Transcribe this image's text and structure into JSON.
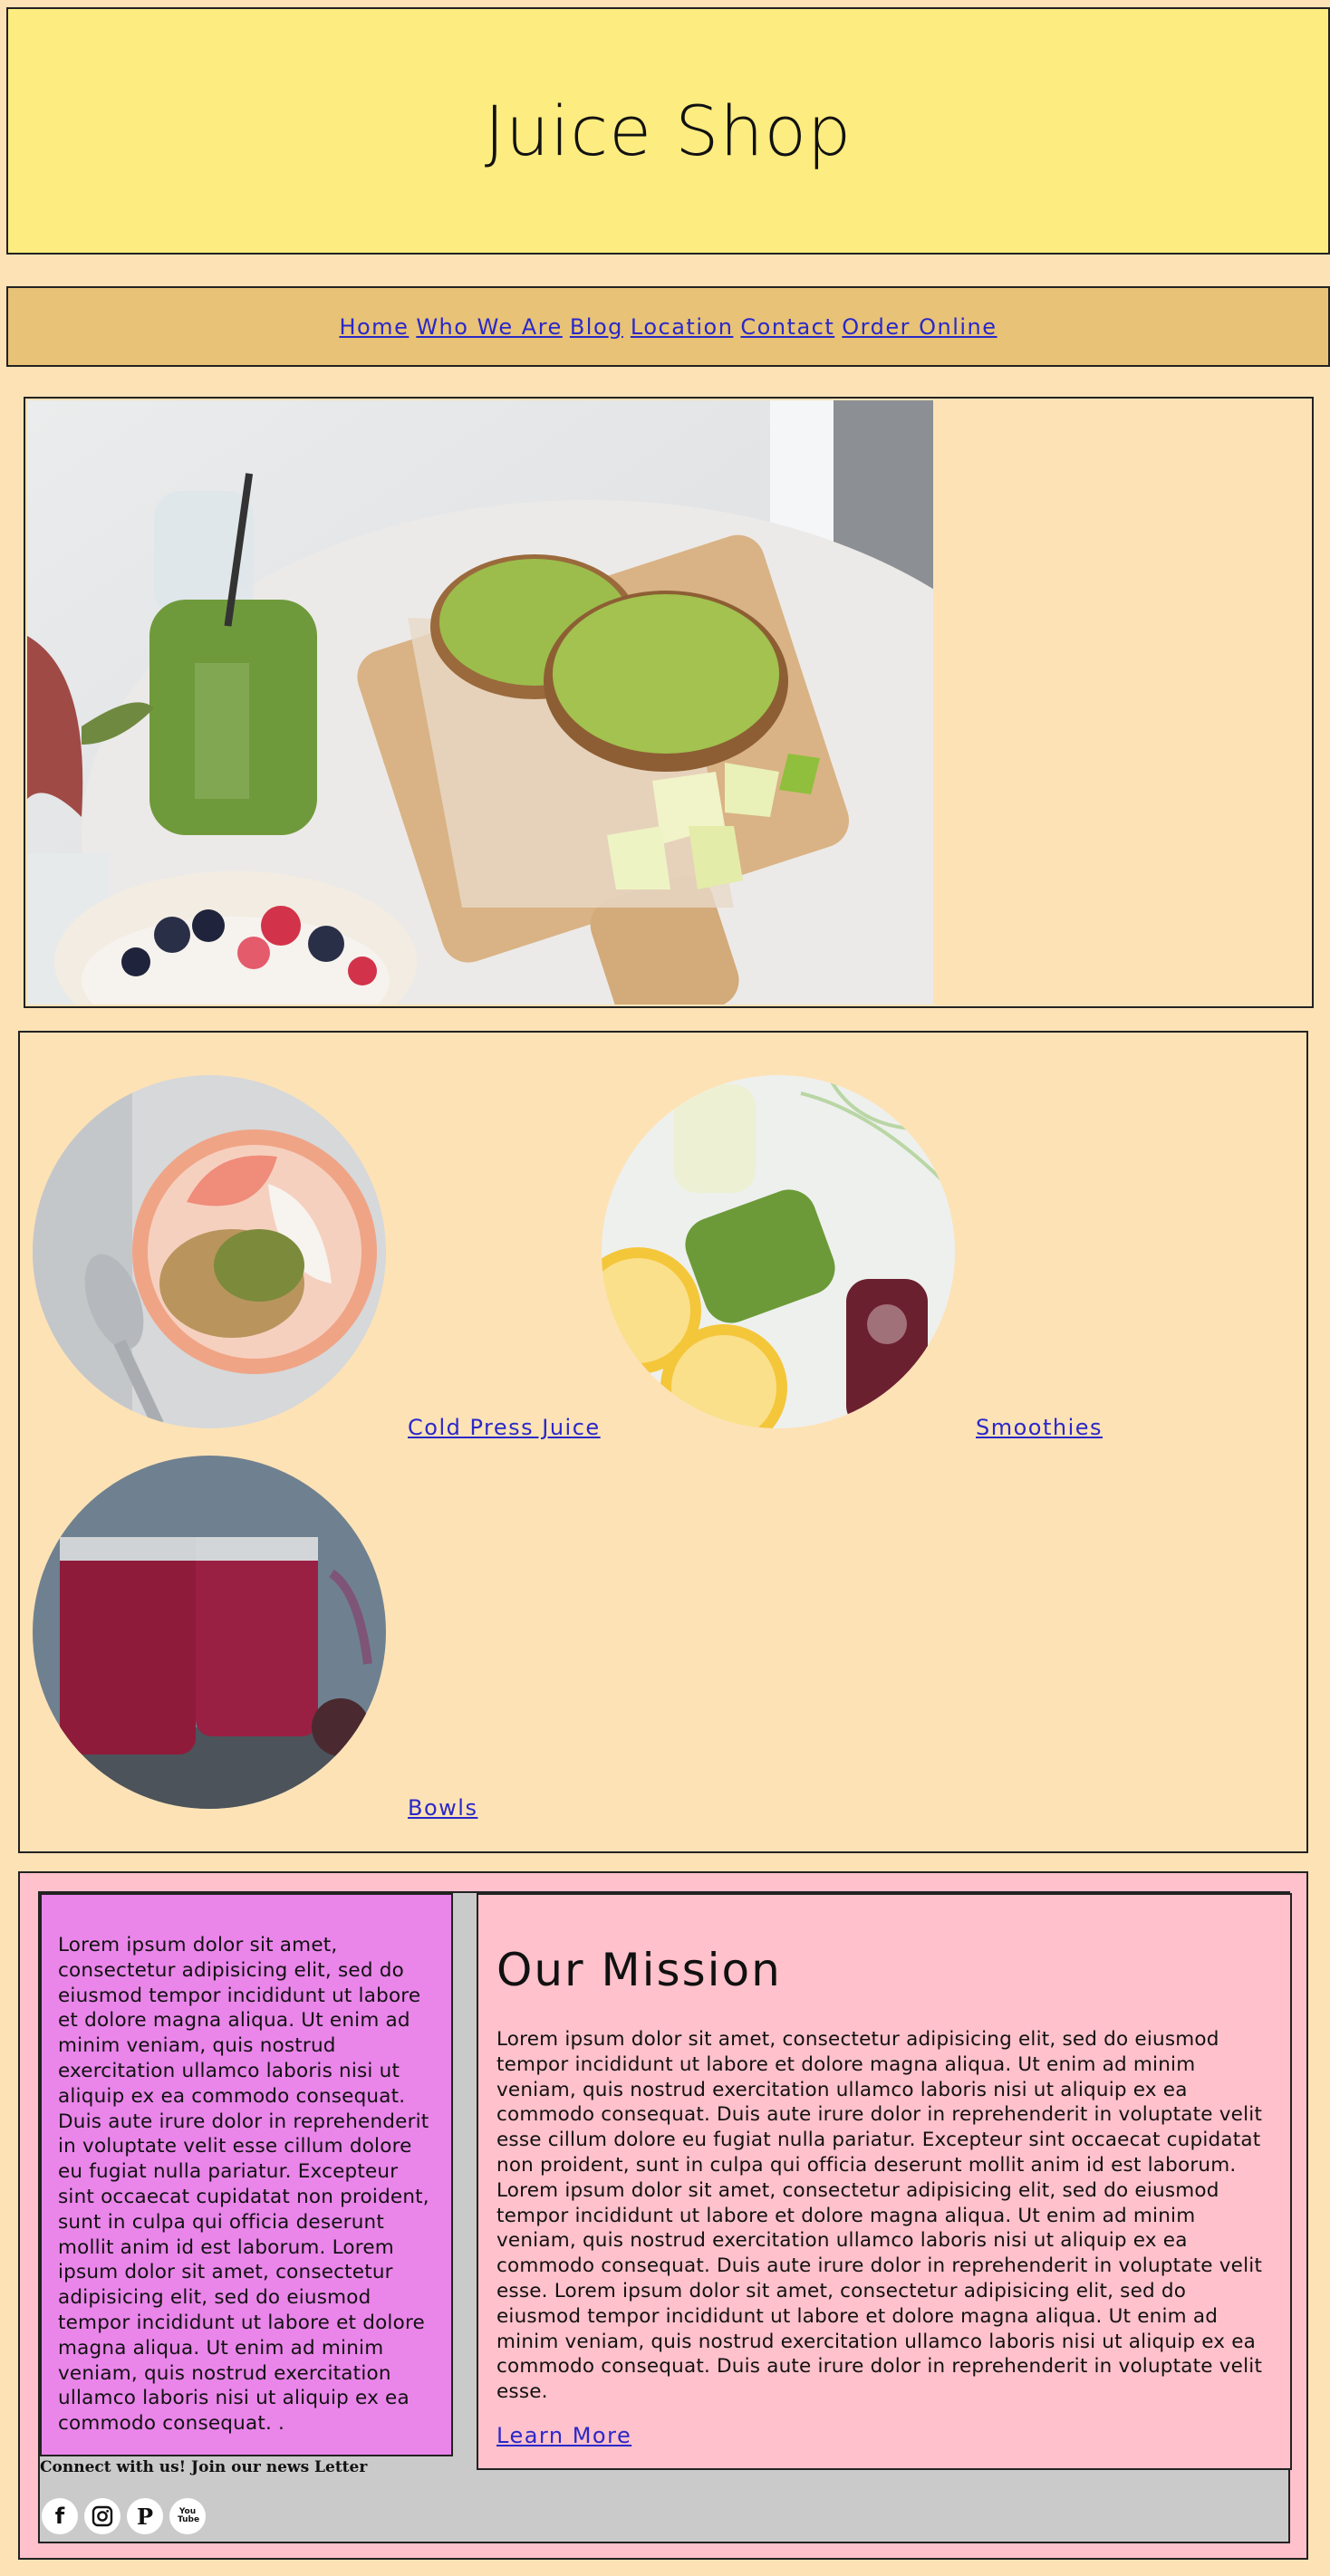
{
  "header": {
    "title": "Juice Shop"
  },
  "nav": {
    "items": [
      {
        "label": "Home"
      },
      {
        "label": "Who We Are"
      },
      {
        "label": "Blog"
      },
      {
        "label": "Location"
      },
      {
        "label": "Contact"
      },
      {
        "label": "Order Online"
      }
    ]
  },
  "products": {
    "items": [
      {
        "label": "Cold Press Juice"
      },
      {
        "label": "Smoothies"
      },
      {
        "label": "Bowls"
      }
    ]
  },
  "intro": {
    "text": "Lorem ipsum dolor sit amet, consectetur adipisicing elit, sed do eiusmod tempor incididunt ut labore et dolore magna aliqua. Ut enim ad minim veniam, quis nostrud exercitation ullamco laboris nisi ut aliquip ex ea commodo consequat. Duis aute irure dolor in reprehenderit in voluptate velit esse cillum dolore eu fugiat nulla pariatur. Excepteur sint occaecat cupidatat non proident, sunt in culpa qui officia deserunt mollit anim id est laborum. Lorem ipsum dolor sit amet, consectetur adipisicing elit, sed do eiusmod tempor incididunt ut labore et dolore magna aliqua. Ut enim ad minim veniam, quis nostrud exercitation ullamco laboris nisi ut aliquip ex ea commodo consequat. ."
  },
  "mission": {
    "title": "Our Mission",
    "text": "Lorem ipsum dolor sit amet, consectetur adipisicing elit, sed do eiusmod tempor incididunt ut labore et dolore magna aliqua. Ut enim ad minim veniam, quis nostrud exercitation ullamco laboris nisi ut aliquip ex ea commodo consequat. Duis aute irure dolor in reprehenderit in voluptate velit esse cillum dolore eu fugiat nulla pariatur. Excepteur sint occaecat cupidatat non proident, sunt in culpa qui officia deserunt mollit anim id est laborum. Lorem ipsum dolor sit amet, consectetur adipisicing elit, sed do eiusmod tempor incididunt ut labore et dolore magna aliqua. Ut enim ad minim veniam, quis nostrud exercitation ullamco laboris nisi ut aliquip ex ea commodo consequat. Duis aute irure dolor in reprehenderit in voluptate velit esse. Lorem ipsum dolor sit amet, consectetur adipisicing elit, sed do eiusmod tempor incididunt ut labore et dolore magna aliqua. Ut enim ad minim veniam, quis nostrud exercitation ullamco laboris nisi ut aliquip ex ea commodo consequat. Duis aute irure dolor in reprehenderit in voluptate velit esse.",
    "link": "Learn More"
  },
  "footer": {
    "connect": "Connect with us! Join our news Letter",
    "socials": [
      {
        "icon": "facebook-icon",
        "glyph": "f"
      },
      {
        "icon": "instagram-icon"
      },
      {
        "icon": "pinterest-icon",
        "glyph": "P"
      },
      {
        "icon": "youtube-icon",
        "glyph": "You Tube"
      }
    ]
  },
  "colors": {
    "page_bg": "#fde2b6",
    "header_bg": "#fdec80",
    "nav_bg": "#e8c276",
    "link": "#2a28c8",
    "intro_bg": "#ea85ea",
    "mission_bg": "#ffc1cb"
  }
}
